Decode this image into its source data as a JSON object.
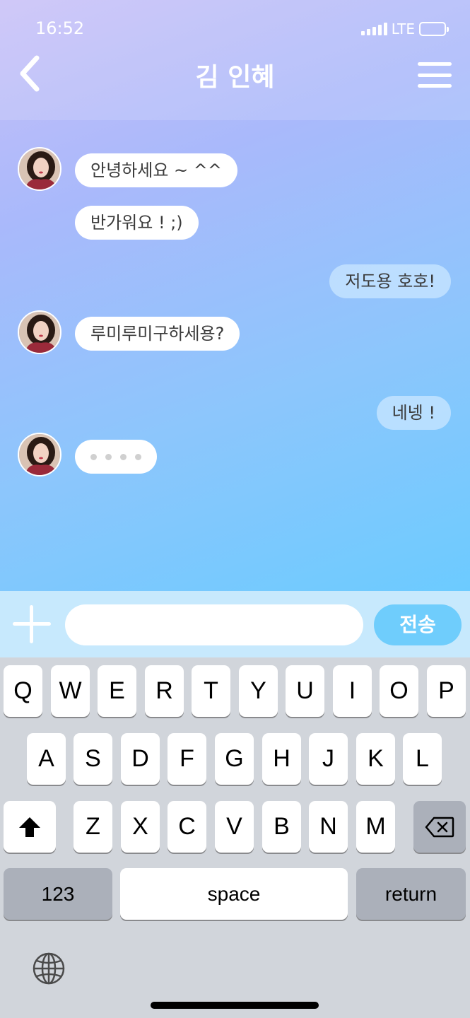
{
  "status": {
    "time": "16:52",
    "network": "LTE"
  },
  "header": {
    "title": "김 인혜"
  },
  "messages": [
    {
      "text": "안녕하세요 ~ ^^"
    },
    {
      "text": "반가워요 ! ;)"
    },
    {
      "text": "저도용 호호!"
    },
    {
      "text": "루미루미구하세용?"
    },
    {
      "text": "네넹 !"
    }
  ],
  "input": {
    "value": "",
    "placeholder": "",
    "send_label": "전송"
  },
  "keyboard": {
    "row1": [
      "Q",
      "W",
      "E",
      "R",
      "T",
      "Y",
      "U",
      "I",
      "O",
      "P"
    ],
    "row2": [
      "A",
      "S",
      "D",
      "F",
      "G",
      "H",
      "J",
      "K",
      "L"
    ],
    "row3": [
      "Z",
      "X",
      "C",
      "V",
      "B",
      "N",
      "M"
    ],
    "numbers_label": "123",
    "space_label": "space",
    "return_label": "return"
  },
  "colors": {
    "accent": "#6fcdfc",
    "gradient_start": "#c8bff7",
    "gradient_end": "#6ccbff"
  },
  "icons": [
    "back-chevron-icon",
    "menu-icon",
    "plus-icon",
    "shift-icon",
    "backspace-icon",
    "globe-icon"
  ]
}
